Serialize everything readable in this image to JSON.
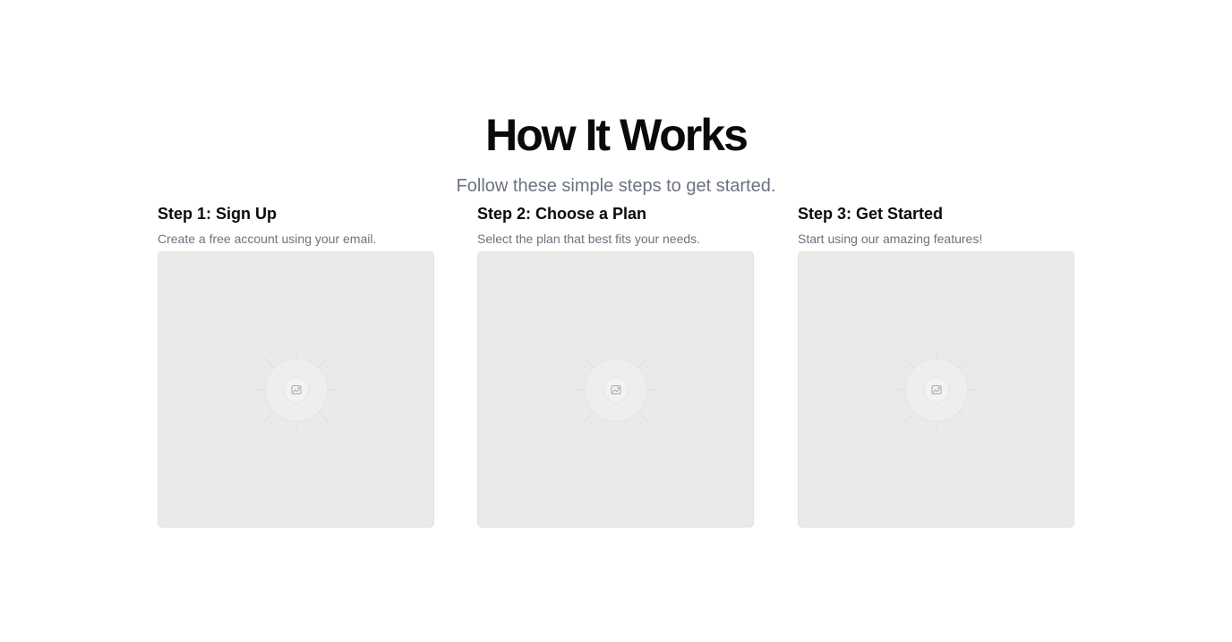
{
  "section": {
    "title": "How It Works",
    "subtitle": "Follow these simple steps to get started."
  },
  "steps": [
    {
      "title": "Step 1: Sign Up",
      "description": "Create a free account using your email.",
      "image_icon": "image-placeholder-icon"
    },
    {
      "title": "Step 2: Choose a Plan",
      "description": "Select the plan that best fits your needs.",
      "image_icon": "image-placeholder-icon"
    },
    {
      "title": "Step 3: Get Started",
      "description": "Start using our amazing features!",
      "image_icon": "image-placeholder-icon"
    }
  ],
  "colors": {
    "heading": "#0a0a0a",
    "muted_text": "#6b7280",
    "placeholder_bg": "#eaeaea"
  }
}
